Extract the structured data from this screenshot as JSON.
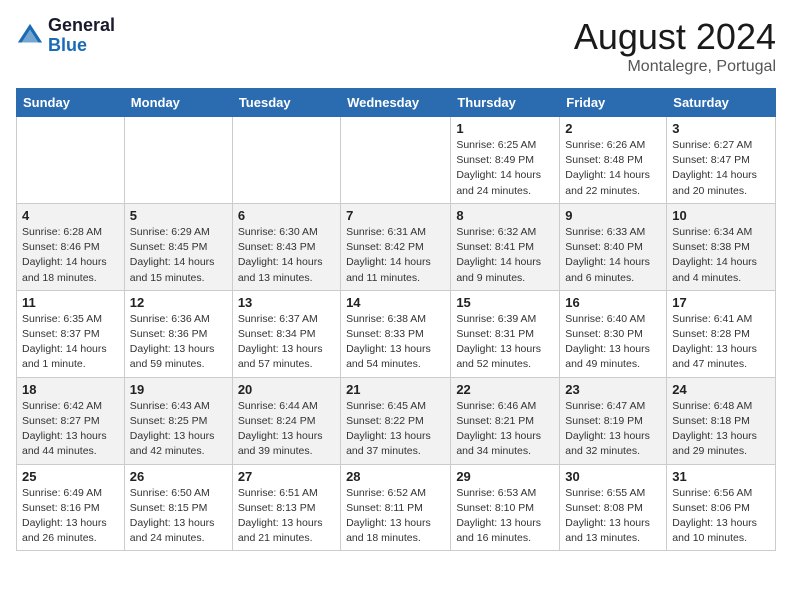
{
  "header": {
    "logo_line1": "General",
    "logo_line2": "Blue",
    "month_year": "August 2024",
    "location": "Montalegre, Portugal"
  },
  "days_of_week": [
    "Sunday",
    "Monday",
    "Tuesday",
    "Wednesday",
    "Thursday",
    "Friday",
    "Saturday"
  ],
  "weeks": [
    [
      {
        "day": "",
        "detail": ""
      },
      {
        "day": "",
        "detail": ""
      },
      {
        "day": "",
        "detail": ""
      },
      {
        "day": "",
        "detail": ""
      },
      {
        "day": "1",
        "detail": "Sunrise: 6:25 AM\nSunset: 8:49 PM\nDaylight: 14 hours and 24 minutes."
      },
      {
        "day": "2",
        "detail": "Sunrise: 6:26 AM\nSunset: 8:48 PM\nDaylight: 14 hours and 22 minutes."
      },
      {
        "day": "3",
        "detail": "Sunrise: 6:27 AM\nSunset: 8:47 PM\nDaylight: 14 hours and 20 minutes."
      }
    ],
    [
      {
        "day": "4",
        "detail": "Sunrise: 6:28 AM\nSunset: 8:46 PM\nDaylight: 14 hours and 18 minutes."
      },
      {
        "day": "5",
        "detail": "Sunrise: 6:29 AM\nSunset: 8:45 PM\nDaylight: 14 hours and 15 minutes."
      },
      {
        "day": "6",
        "detail": "Sunrise: 6:30 AM\nSunset: 8:43 PM\nDaylight: 14 hours and 13 minutes."
      },
      {
        "day": "7",
        "detail": "Sunrise: 6:31 AM\nSunset: 8:42 PM\nDaylight: 14 hours and 11 minutes."
      },
      {
        "day": "8",
        "detail": "Sunrise: 6:32 AM\nSunset: 8:41 PM\nDaylight: 14 hours and 9 minutes."
      },
      {
        "day": "9",
        "detail": "Sunrise: 6:33 AM\nSunset: 8:40 PM\nDaylight: 14 hours and 6 minutes."
      },
      {
        "day": "10",
        "detail": "Sunrise: 6:34 AM\nSunset: 8:38 PM\nDaylight: 14 hours and 4 minutes."
      }
    ],
    [
      {
        "day": "11",
        "detail": "Sunrise: 6:35 AM\nSunset: 8:37 PM\nDaylight: 14 hours and 1 minute."
      },
      {
        "day": "12",
        "detail": "Sunrise: 6:36 AM\nSunset: 8:36 PM\nDaylight: 13 hours and 59 minutes."
      },
      {
        "day": "13",
        "detail": "Sunrise: 6:37 AM\nSunset: 8:34 PM\nDaylight: 13 hours and 57 minutes."
      },
      {
        "day": "14",
        "detail": "Sunrise: 6:38 AM\nSunset: 8:33 PM\nDaylight: 13 hours and 54 minutes."
      },
      {
        "day": "15",
        "detail": "Sunrise: 6:39 AM\nSunset: 8:31 PM\nDaylight: 13 hours and 52 minutes."
      },
      {
        "day": "16",
        "detail": "Sunrise: 6:40 AM\nSunset: 8:30 PM\nDaylight: 13 hours and 49 minutes."
      },
      {
        "day": "17",
        "detail": "Sunrise: 6:41 AM\nSunset: 8:28 PM\nDaylight: 13 hours and 47 minutes."
      }
    ],
    [
      {
        "day": "18",
        "detail": "Sunrise: 6:42 AM\nSunset: 8:27 PM\nDaylight: 13 hours and 44 minutes."
      },
      {
        "day": "19",
        "detail": "Sunrise: 6:43 AM\nSunset: 8:25 PM\nDaylight: 13 hours and 42 minutes."
      },
      {
        "day": "20",
        "detail": "Sunrise: 6:44 AM\nSunset: 8:24 PM\nDaylight: 13 hours and 39 minutes."
      },
      {
        "day": "21",
        "detail": "Sunrise: 6:45 AM\nSunset: 8:22 PM\nDaylight: 13 hours and 37 minutes."
      },
      {
        "day": "22",
        "detail": "Sunrise: 6:46 AM\nSunset: 8:21 PM\nDaylight: 13 hours and 34 minutes."
      },
      {
        "day": "23",
        "detail": "Sunrise: 6:47 AM\nSunset: 8:19 PM\nDaylight: 13 hours and 32 minutes."
      },
      {
        "day": "24",
        "detail": "Sunrise: 6:48 AM\nSunset: 8:18 PM\nDaylight: 13 hours and 29 minutes."
      }
    ],
    [
      {
        "day": "25",
        "detail": "Sunrise: 6:49 AM\nSunset: 8:16 PM\nDaylight: 13 hours and 26 minutes."
      },
      {
        "day": "26",
        "detail": "Sunrise: 6:50 AM\nSunset: 8:15 PM\nDaylight: 13 hours and 24 minutes."
      },
      {
        "day": "27",
        "detail": "Sunrise: 6:51 AM\nSunset: 8:13 PM\nDaylight: 13 hours and 21 minutes."
      },
      {
        "day": "28",
        "detail": "Sunrise: 6:52 AM\nSunset: 8:11 PM\nDaylight: 13 hours and 18 minutes."
      },
      {
        "day": "29",
        "detail": "Sunrise: 6:53 AM\nSunset: 8:10 PM\nDaylight: 13 hours and 16 minutes."
      },
      {
        "day": "30",
        "detail": "Sunrise: 6:55 AM\nSunset: 8:08 PM\nDaylight: 13 hours and 13 minutes."
      },
      {
        "day": "31",
        "detail": "Sunrise: 6:56 AM\nSunset: 8:06 PM\nDaylight: 13 hours and 10 minutes."
      }
    ]
  ]
}
